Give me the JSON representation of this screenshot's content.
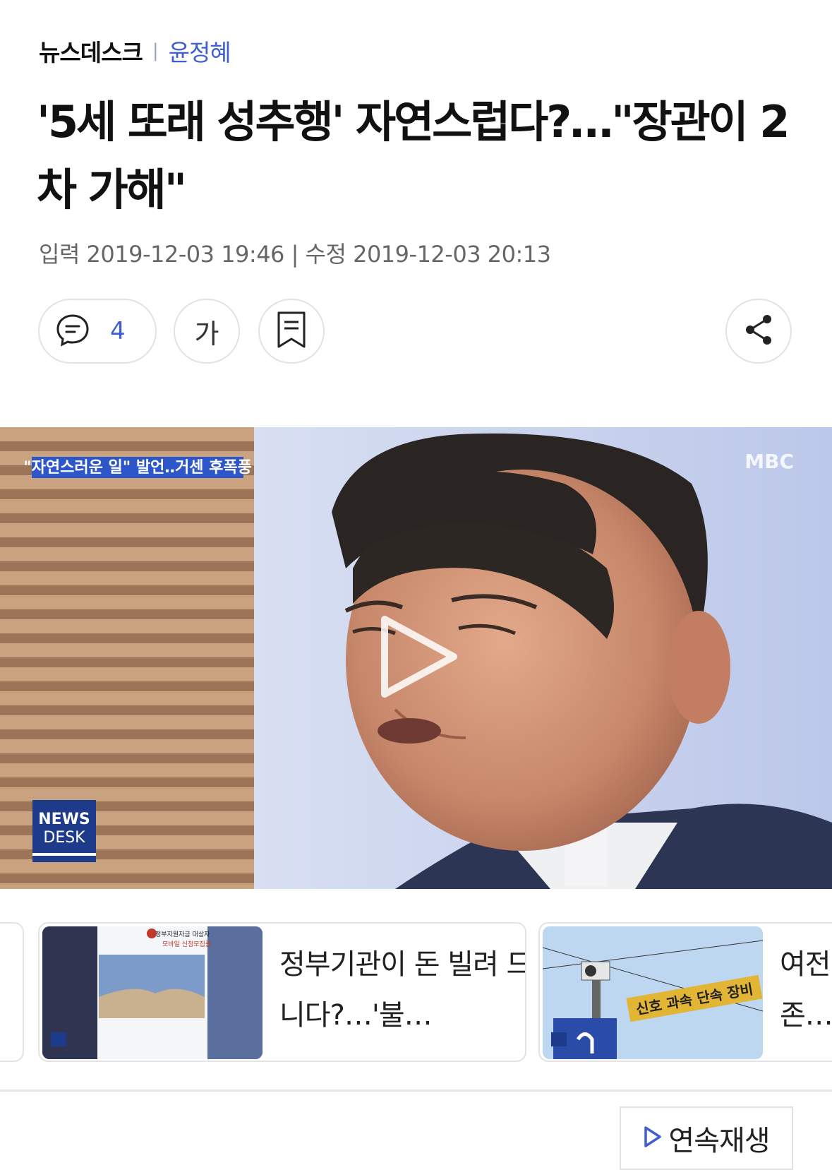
{
  "article": {
    "program": "뉴스데스크",
    "separator": "|",
    "reporter": "윤정혜",
    "headline": "'5세 또래 성추행' 자연스럽다?…\"장관이 2차 가해\"",
    "dates": "입력 2019-12-03 19:46 | 수정 2019-12-03 20:13"
  },
  "toolbar": {
    "comment_count": "4",
    "font_size_label": "가"
  },
  "video": {
    "caption": "\"자연스러운 일\" 발언‥거센 후폭풍",
    "channel_logo": "MBC",
    "program_logo_line1": "NEWS",
    "program_logo_line2": "DESK"
  },
  "related": [
    {
      "title": "정부기관이 돈 빌려 드립니다?…'불…",
      "thumb_caption_top": "정부지원자금 대상자",
      "thumb_caption_sub": "모바일 신청모집중"
    },
    {
      "title": "여전 존…",
      "thumb_sign": "신호 과속 단속 장비"
    }
  ],
  "autoplay": {
    "label": "연속재생"
  },
  "colors": {
    "accent": "#3f5fd0",
    "border": "#e2e2e2",
    "text": "#111111"
  }
}
